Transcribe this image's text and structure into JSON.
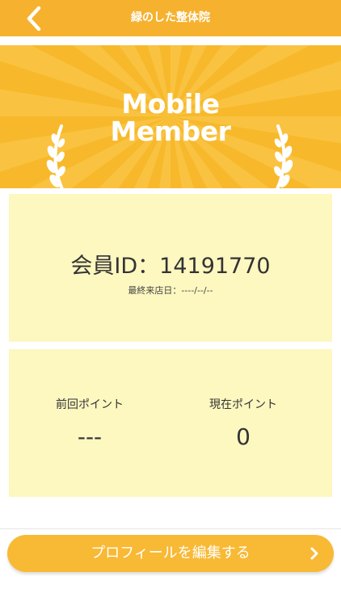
{
  "header": {
    "title": "緑のした整体院",
    "back_icon": "chevron-left-icon"
  },
  "banner": {
    "title_line1": "Mobile",
    "title_line2": "Member",
    "decoration_icon": "laurel-icon"
  },
  "member": {
    "id_label": "会員ID：",
    "id_value": "14191770",
    "last_visit_label": "最終来店日：",
    "last_visit_value": "----/--/--"
  },
  "points": {
    "previous_label": "前回ポイント",
    "previous_value": "---",
    "current_label": "現在ポイント",
    "current_value": "0"
  },
  "footer": {
    "edit_profile_label": "プロフィールを編集する",
    "chevron_icon": "chevron-right-icon"
  },
  "colors": {
    "accent": "#f6b12f",
    "card_background": "#fdf7c0",
    "text": "#333333"
  }
}
